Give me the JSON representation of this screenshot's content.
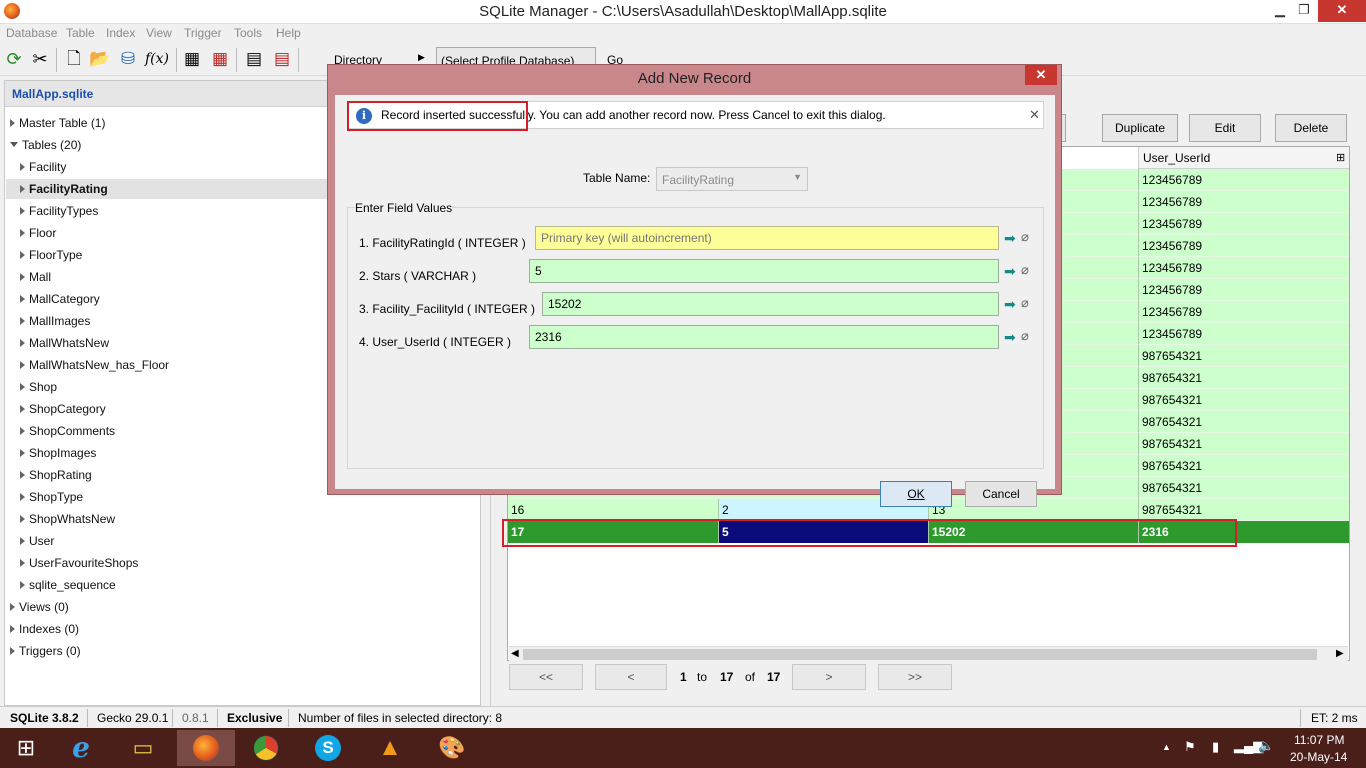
{
  "window": {
    "title": "SQLite Manager - C:\\Users\\Asadullah\\Desktop\\MallApp.sqlite",
    "minimize": "▁",
    "restore": "❐",
    "close": "✕"
  },
  "menubar": {
    "items": [
      "Database",
      "Table",
      "Index",
      "View",
      "Trigger",
      "Tools",
      "Help"
    ]
  },
  "toolbar": {
    "directory_label": "Directory",
    "profile_select": "(Select Profile Database)",
    "go_label": "Go",
    "icons": [
      "refresh-icon",
      "tools-icon",
      "new-db-icon",
      "open-db-icon",
      "connect-db-icon",
      "function-icon",
      "create-table-icon",
      "drop-table-icon",
      "create-index-icon",
      "drop-index-icon"
    ]
  },
  "left_panel": {
    "db_name": "MallApp.sqlite",
    "master_table": "Master Table (1)",
    "tables_header": "Tables (20)",
    "tables": [
      "Facility",
      "FacilityRating",
      "FacilityTypes",
      "Floor",
      "FloorType",
      "Mall",
      "MallCategory",
      "MallImages",
      "MallWhatsNew",
      "MallWhatsNew_has_Floor",
      "Shop",
      "ShopCategory",
      "ShopComments",
      "ShopImages",
      "ShopRating",
      "ShopType",
      "ShopWhatsNew",
      "User",
      "UserFavouriteShops",
      "sqlite_sequence"
    ],
    "selected_table": "FacilityRating",
    "views": "Views (0)",
    "indexes": "Indexes (0)",
    "triggers": "Triggers (0)"
  },
  "actions": {
    "duplicate": "Duplicate",
    "edit": "Edit",
    "delete": "Delete"
  },
  "grid": {
    "visible_header": "User_UserId",
    "user_ids_top": [
      "123456789",
      "123456789",
      "123456789",
      "123456789",
      "123456789",
      "123456789",
      "123456789",
      "123456789",
      "987654321",
      "987654321",
      "987654321",
      "987654321",
      "987654321",
      "987654321",
      "987654321"
    ],
    "row16": [
      "16",
      "2",
      "13",
      "987654321"
    ],
    "row17": [
      "17",
      "5",
      "15202",
      "2316"
    ]
  },
  "pager": {
    "first": "<<",
    "prev": "<",
    "from": "1",
    "to_label": "to",
    "to": "17",
    "of_label": "of",
    "total": "17",
    "next": ">",
    "last": ">>"
  },
  "status": {
    "sqlite": "SQLite 3.8.2",
    "gecko": "Gecko 29.0.1",
    "ver": "0.8.1",
    "mode": "Exclusive",
    "files": "Number of files in selected directory: 8",
    "et": "ET: 2 ms"
  },
  "taskbar": {
    "time": "11:07 PM",
    "date": "20-May-14"
  },
  "dialog": {
    "title": "Add New Record",
    "close": "✕",
    "notice": "Record inserted successfully. You can add another record now. Press Cancel to exit this dialog.",
    "notice_close": "✕",
    "table_name_label": "Table Name:",
    "table_name_value": "FacilityRating",
    "group_label": "Enter Field Values",
    "fields": [
      {
        "label": "1. FacilityRatingId ( INTEGER )",
        "value": "",
        "placeholder": "Primary key (will autoincrement)"
      },
      {
        "label": "2. Stars ( VARCHAR )",
        "value": "5",
        "placeholder": ""
      },
      {
        "label": "3. Facility_FacilityId ( INTEGER )",
        "value": "15202",
        "placeholder": ""
      },
      {
        "label": "4. User_UserId ( INTEGER )",
        "value": "2316",
        "placeholder": ""
      }
    ],
    "ok": "OK",
    "cancel": "Cancel"
  }
}
